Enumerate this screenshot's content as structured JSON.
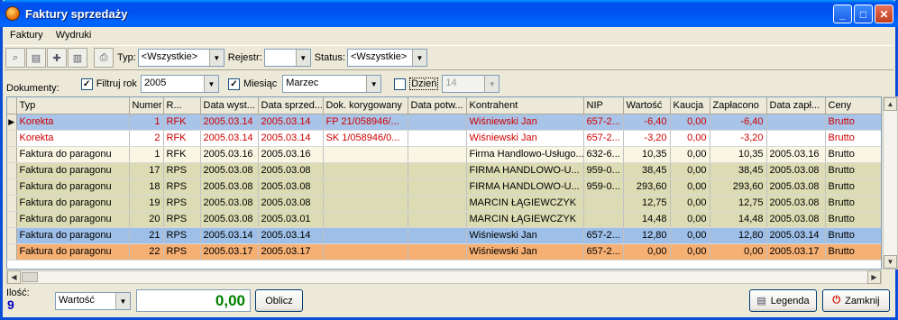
{
  "window": {
    "title": "Faktury sprzedaży"
  },
  "menu": {
    "items": [
      "Faktury",
      "Wydruki"
    ]
  },
  "toolbar": {
    "typ_label": "Typ:",
    "typ_value": "<Wszystkie>",
    "rejestr_label": "Rejestr:",
    "rejestr_value": "",
    "status_label": "Status:",
    "status_value": "<Wszystkie>"
  },
  "filters": {
    "dokumenty_label": "Dokumenty:",
    "filtruj_rok_label": "Filtruj rok",
    "rok_value": "2005",
    "miesiac_label": "Miesiąc",
    "miesiac_value": "Marzec",
    "dzien_label": "Dzień",
    "dzien_value": "14"
  },
  "grid": {
    "columns": [
      "Typ",
      "Numer",
      "R...",
      "Data wyst...",
      "Data sprzed...",
      "Dok. korygowany",
      "Data potw...",
      "Kontrahent",
      "NIP",
      "Wartość",
      "Kaucja",
      "Zapłacono",
      "Data zapł...",
      "Ceny"
    ],
    "rows": [
      {
        "style": "sel-blue korekta",
        "current": true,
        "cells": [
          "Korekta",
          "1",
          "RFK",
          "2005.03.14",
          "2005.03.14",
          "FP 21/058946/...",
          "",
          "Wiśniewski Jan",
          "657-2...",
          "-6,40",
          "0,00",
          "-6,40",
          "",
          "Brutto"
        ]
      },
      {
        "style": "white korekta",
        "current": false,
        "cells": [
          "Korekta",
          "2",
          "RFK",
          "2005.03.14",
          "2005.03.14",
          "SK 1/058946/0...",
          "",
          "Wiśniewski Jan",
          "657-2...",
          "-3,20",
          "0,00",
          "-3,20",
          "",
          "Brutto"
        ]
      },
      {
        "style": "cream",
        "current": false,
        "cells": [
          "Faktura do paragonu",
          "1",
          "RFK",
          "2005.03.16",
          "2005.03.16",
          "",
          "",
          "Firma Handlowo-Usługo...",
          "632-6...",
          "10,35",
          "0,00",
          "10,35",
          "2005.03.16",
          "Brutto"
        ]
      },
      {
        "style": "green",
        "current": false,
        "cells": [
          "Faktura do paragonu",
          "17",
          "RPS",
          "2005.03.08",
          "2005.03.08",
          "",
          "",
          "FIRMA HANDLOWO-U...",
          "959-0...",
          "38,45",
          "0,00",
          "38,45",
          "2005.03.08",
          "Brutto"
        ]
      },
      {
        "style": "green",
        "current": false,
        "cells": [
          "Faktura do paragonu",
          "18",
          "RPS",
          "2005.03.08",
          "2005.03.08",
          "",
          "",
          "FIRMA HANDLOWO-U...",
          "959-0...",
          "293,60",
          "0,00",
          "293,60",
          "2005.03.08",
          "Brutto"
        ]
      },
      {
        "style": "green",
        "current": false,
        "cells": [
          "Faktura do paragonu",
          "19",
          "RPS",
          "2005.03.08",
          "2005.03.08",
          "",
          "",
          "MARCIN ŁĄGIEWCZYK",
          "",
          "12,75",
          "0,00",
          "12,75",
          "2005.03.08",
          "Brutto"
        ]
      },
      {
        "style": "green",
        "current": false,
        "cells": [
          "Faktura do paragonu",
          "20",
          "RPS",
          "2005.03.08",
          "2005.03.01",
          "",
          "",
          "MARCIN ŁĄGIEWCZYK",
          "",
          "14,48",
          "0,00",
          "14,48",
          "2005.03.08",
          "Brutto"
        ]
      },
      {
        "style": "blue",
        "current": false,
        "cells": [
          "Faktura do paragonu",
          "21",
          "RPS",
          "2005.03.14",
          "2005.03.14",
          "",
          "",
          "Wiśniewski Jan",
          "657-2...",
          "12,80",
          "0,00",
          "12,80",
          "2005.03.14",
          "Brutto"
        ]
      },
      {
        "style": "orange",
        "current": false,
        "cells": [
          "Faktura do paragonu",
          "22",
          "RPS",
          "2005.03.17",
          "2005.03.17",
          "",
          "",
          "Wiśniewski Jan",
          "657-2...",
          "0,00",
          "0,00",
          "0,00",
          "2005.03.17",
          "Brutto"
        ]
      }
    ]
  },
  "footer": {
    "ilosc_label": "Ilość:",
    "ilosc_value": "9",
    "agg_value": "Wartość",
    "sum_value": "0,00",
    "oblicz_label": "Oblicz",
    "legenda_label": "Legenda",
    "zamknij_label": "Zamknij"
  }
}
